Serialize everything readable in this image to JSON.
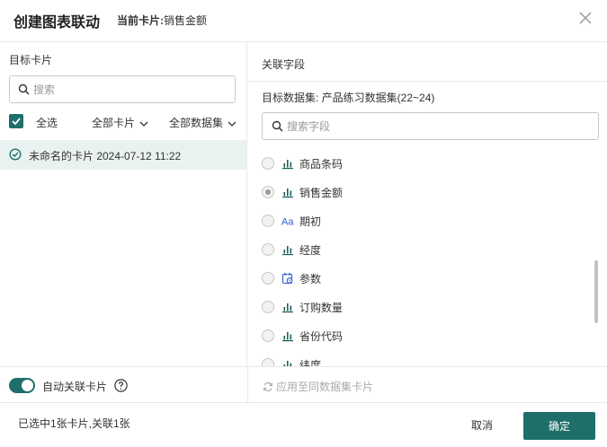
{
  "header": {
    "title": "创建图表联动",
    "current_card_label": "当前卡片:",
    "current_card_value": "销售金额"
  },
  "left": {
    "label": "目标卡片",
    "search_placeholder": "搜索",
    "select_all": "全选",
    "filter_cards": "全部卡片",
    "filter_datasets": "全部数据集",
    "cards": [
      {
        "label": "未命名的卡片 2024-07-12 11:22",
        "checked": true
      }
    ]
  },
  "right": {
    "label": "关联字段",
    "dataset_label": "目标数据集: 产品练习数据集(22~24)",
    "search_placeholder": "搜索字段",
    "fields": [
      {
        "name": "商品条码",
        "icon": "bar-chart-icon",
        "selected": false
      },
      {
        "name": "销售金额",
        "icon": "bar-chart-icon",
        "selected": true
      },
      {
        "name": "期初",
        "icon": "text-type-icon",
        "selected": false
      },
      {
        "name": "经度",
        "icon": "bar-chart-icon",
        "selected": false
      },
      {
        "name": "参数",
        "icon": "parameter-icon",
        "selected": false
      },
      {
        "name": "订购数量",
        "icon": "bar-chart-icon",
        "selected": false
      },
      {
        "name": "省份代码",
        "icon": "bar-chart-icon",
        "selected": false
      },
      {
        "name": "纬度",
        "icon": "bar-chart-icon",
        "selected": false
      }
    ]
  },
  "bottom": {
    "auto_link_label": "自动关联卡片",
    "auto_link_on": true,
    "apply_label": "应用至同数据集卡片"
  },
  "footer": {
    "status": "已选中1张卡片,关联1张",
    "cancel": "取消",
    "confirm": "确定"
  },
  "colors": {
    "accent": "#1e6f6a",
    "selected_row": "#e9f2f1"
  }
}
